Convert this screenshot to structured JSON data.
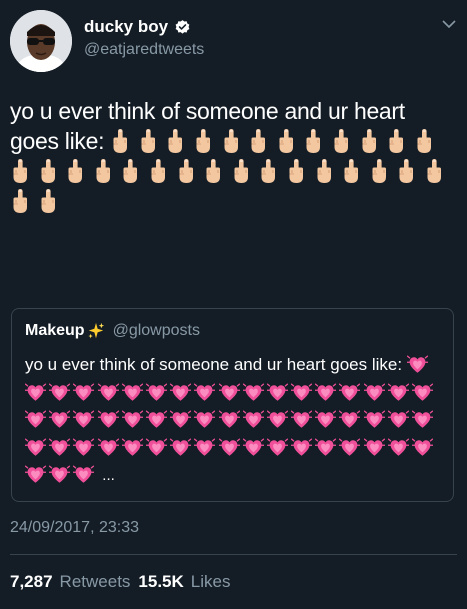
{
  "author": {
    "display_name": "ducky boy",
    "handle": "@eatjaredtweets",
    "verified": true,
    "avatar_icon": "avatar-photo"
  },
  "tweet": {
    "text": "yo u ever think of someone and ur heart goes like:",
    "emoji_name": "middle-finger-emoji",
    "emoji_count": 30
  },
  "quoted_tweet": {
    "display_name": "Makeup",
    "name_emoji": "sparkles-icon",
    "handle": "@glowposts",
    "text": "yo u ever think of someone and ur heart goes like:",
    "emoji_name": "beating-heart-emoji",
    "emoji_count": 55,
    "truncation": "..."
  },
  "timestamp": "24/09/2017, 23:33",
  "stats": {
    "retweets_count": "7,287",
    "retweets_label": "Retweets",
    "likes_count": "15.5K",
    "likes_label": "Likes"
  },
  "colors": {
    "background": "#141d26",
    "text": "#ffffff",
    "secondary_text": "#8899a6",
    "border": "#38444d",
    "verified_badge": "#ffffff",
    "heart_pink": "#f0509a"
  }
}
